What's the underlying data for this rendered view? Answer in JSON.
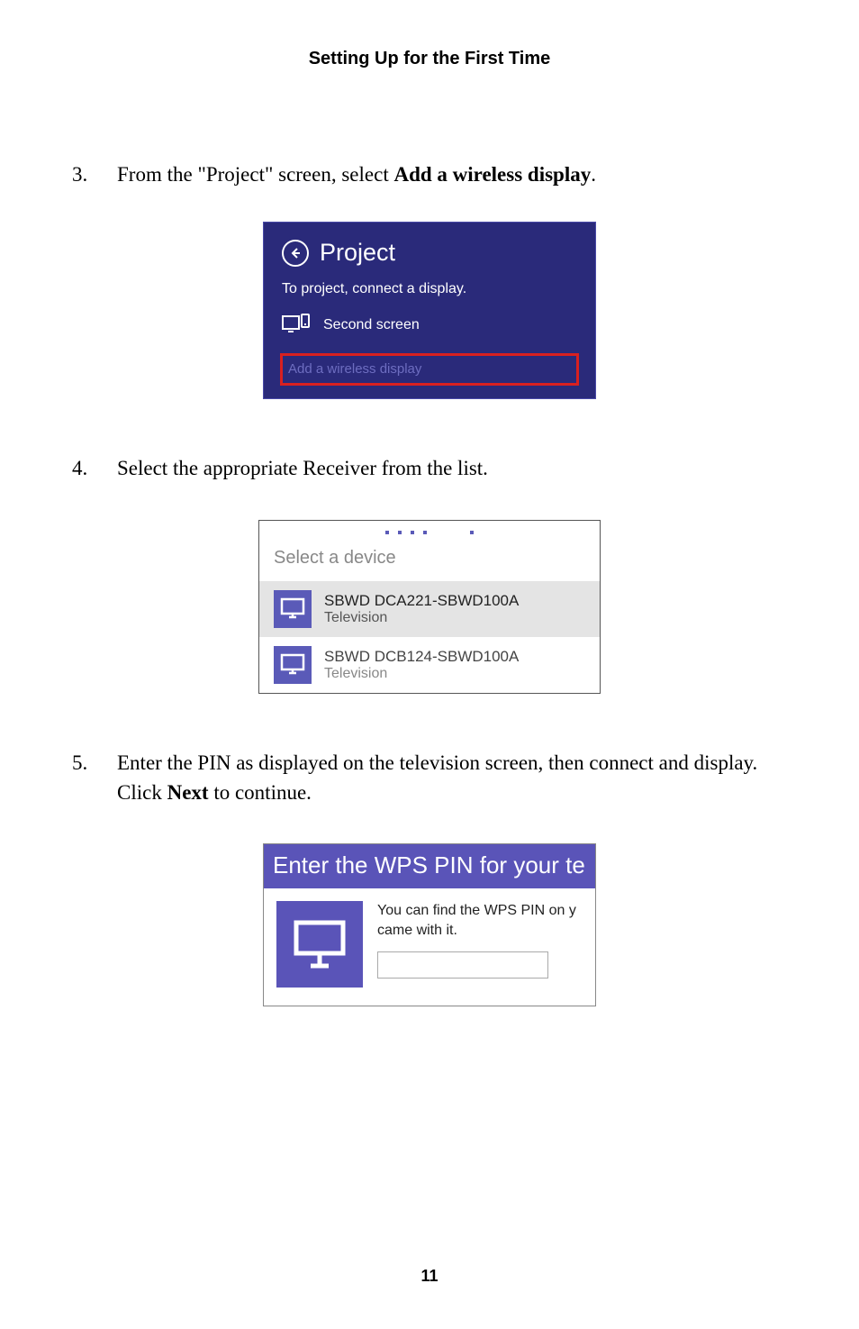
{
  "header": "Setting Up for the First Time",
  "page_number": "11",
  "steps": {
    "s3": {
      "num": "3.",
      "pre": "From the \"Project\" screen, select ",
      "bold": "Add a wireless display",
      "post": "."
    },
    "s4": {
      "num": "4.",
      "text": "Select the appropriate Receiver from the list."
    },
    "s5": {
      "num": "5.",
      "pre": "Enter the PIN as displayed on the television screen, then connect and display. Click ",
      "bold": "Next",
      "post": " to continue."
    }
  },
  "project_panel": {
    "title": "Project",
    "subtitle": "To project, connect a display.",
    "second_screen": "Second screen",
    "add_wireless": "Add a wireless display"
  },
  "select_panel": {
    "title": "Select a device",
    "devices": [
      {
        "name": "SBWD DCA221-SBWD100A",
        "type": "Television"
      },
      {
        "name": "SBWD DCB124-SBWD100A",
        "type": "Television"
      }
    ]
  },
  "wps_panel": {
    "header": "Enter the WPS PIN for your te",
    "hint_line1": "You can find the WPS PIN on y",
    "hint_line2": "came with it.",
    "input_value": ""
  }
}
